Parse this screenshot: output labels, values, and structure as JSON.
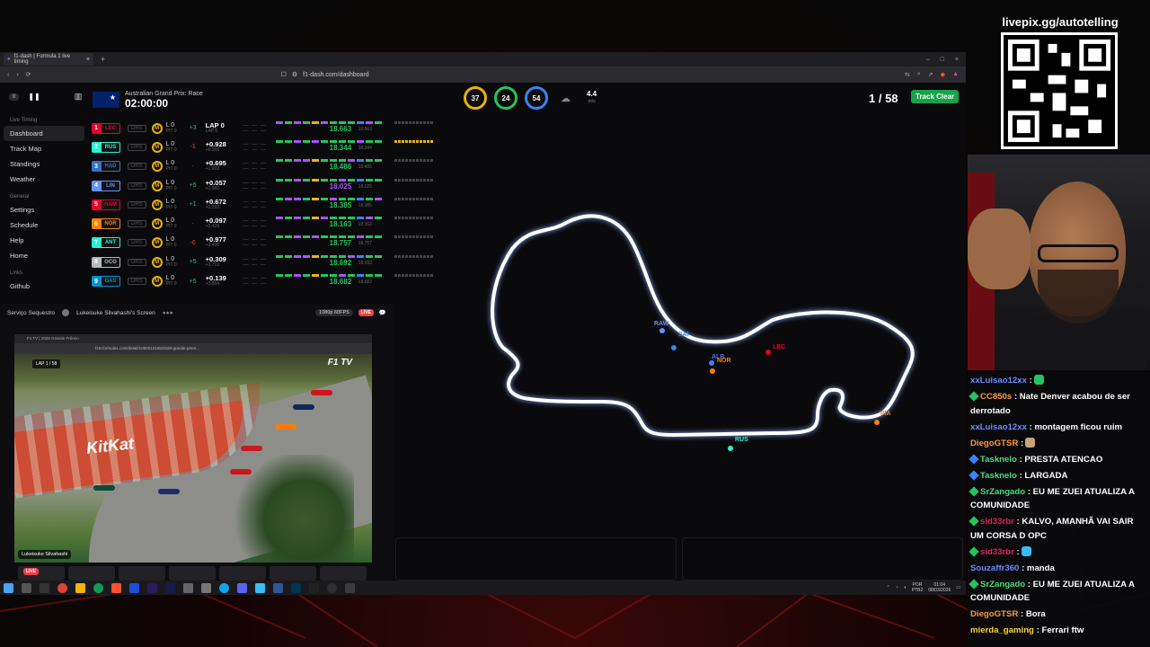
{
  "stream": {
    "title": "livepix.gg/autotelling"
  },
  "browser": {
    "tab_title": "f1-dash | Formula 1 live timing",
    "url": "f1-dash.com/dashboard"
  },
  "sidebar": {
    "delay_value": "0",
    "section_live": "Live Timing",
    "live_items": [
      "Dashboard",
      "Track Map",
      "Standings",
      "Weather"
    ],
    "section_general": "General",
    "general_items": [
      "Settings",
      "Schedule",
      "Help",
      "Home"
    ],
    "section_links": "Links",
    "link_items": [
      "Github"
    ]
  },
  "header": {
    "race_name": "Australian Grand Prix: Race",
    "race_clock": "02:00:00",
    "gauges": [
      {
        "value": "37",
        "label": "TRC"
      },
      {
        "value": "24",
        "label": "AIR"
      },
      {
        "value": "54",
        "label": "%"
      }
    ],
    "wind_value": "4.4",
    "wind_unit": "m/s",
    "lap_counter": "1 / 58",
    "track_status": "Track Clear"
  },
  "leaderboard": [
    {
      "pos": "1",
      "code": "LEC",
      "color": "#e8002d",
      "drs": "DRS",
      "laps": "L 0",
      "pit": "PIT 0",
      "chg": "+3",
      "dir": "up",
      "gap": "LAP 0",
      "gap2": "LAP 0",
      "s_time": "18.663",
      "s_time2": "18.663"
    },
    {
      "pos": "2",
      "code": "RUS",
      "color": "#27f4d2",
      "drs": "DRS",
      "laps": "L 0",
      "pit": "PIT 0",
      "chg": "-1",
      "dir": "down",
      "gap": "+0.928",
      "gap2": "+0.928",
      "s_time": "18.344",
      "s_time2": "18.344"
    },
    {
      "pos": "3",
      "code": "HAD",
      "color": "#3671c6",
      "drs": "DRS",
      "laps": "L 0",
      "pit": "PIT 0",
      "chg": "-",
      "dir": "none",
      "gap": "+0.695",
      "gap2": "+1.603",
      "s_time": "18.486",
      "s_time2": "18.486"
    },
    {
      "pos": "4",
      "code": "LIN",
      "color": "#6692ff",
      "drs": "DRS",
      "laps": "L 0",
      "pit": "PIT 0",
      "chg": "+5",
      "dir": "up",
      "gap": "+0.057",
      "gap2": "+1.660",
      "s_time": "18.025",
      "s_time2": "18.025"
    },
    {
      "pos": "5",
      "code": "HAM",
      "color": "#e8002d",
      "drs": "DRS",
      "laps": "L 0",
      "pit": "PIT 0",
      "chg": "+1",
      "dir": "up",
      "gap": "+0.672",
      "gap2": "+2.332",
      "s_time": "18.385",
      "s_time2": "18.385"
    },
    {
      "pos": "6",
      "code": "NOR",
      "color": "#ff8000",
      "drs": "DRS",
      "laps": "L 0",
      "pit": "PIT 0",
      "chg": "-",
      "dir": "none",
      "gap": "+0.097",
      "gap2": "+2.429",
      "s_time": "18.163",
      "s_time2": "18.163"
    },
    {
      "pos": "7",
      "code": "ANT",
      "color": "#27f4d2",
      "drs": "DRS",
      "laps": "L 0",
      "pit": "PIT 0",
      "chg": "-6",
      "dir": "down",
      "gap": "+0.977",
      "gap2": "+3.406",
      "s_time": "18.757",
      "s_time2": "18.757"
    },
    {
      "pos": "8",
      "code": "OCO",
      "color": "#b6babd",
      "drs": "DRS",
      "laps": "L 0",
      "pit": "PIT 0",
      "chg": "+5",
      "dir": "up",
      "gap": "+0.309",
      "gap2": "+3.715",
      "s_time": "18.692",
      "s_time2": "18.692"
    },
    {
      "pos": "9",
      "code": "GAS",
      "color": "#0093cc",
      "drs": "DRS",
      "laps": "L 0",
      "pit": "PIT 0",
      "chg": "+5",
      "dir": "up",
      "gap": "+0.139",
      "gap2": "+3.854",
      "s_time": "18.682",
      "s_time2": "18.682"
    }
  ],
  "track_map": {
    "drivers": [
      {
        "code": "RAW",
        "color": "#6692ff"
      },
      {
        "code": "SAI",
        "color": "#3b82f6"
      },
      {
        "code": "ALB",
        "color": "#3b82f6"
      },
      {
        "code": "NOR",
        "color": "#ff8000"
      },
      {
        "code": "LEC",
        "color": "#e8002d"
      },
      {
        "code": "PIA",
        "color": "#ff8000"
      },
      {
        "code": "RUS",
        "color": "#27f4d2"
      }
    ]
  },
  "discord": {
    "server": "Serviço Sequestro",
    "screen_title": "Lukeisuke Silvahashi's Screen",
    "quality": "1080p 60FPS",
    "live": "LIVE",
    "inner_tab": "F1 TV | 2026 Grande Prêmio",
    "inner_url": "f1tv.formula1.com/detail/1000010165/2026-grande-prem...",
    "lap_overlay": "LAP 1 / 58",
    "f1tv_logo": "F1 TV",
    "kitkat": "KitKat",
    "streamer_tag": "Lukeisuke Silvahashi"
  },
  "taskbar": {
    "lang": "POR",
    "layout": "PTB2",
    "time": "01:04",
    "date": "08/03/2026"
  },
  "chat": [
    {
      "user": "xxLuisao12xx",
      "color": "#6b8cff",
      "badge": "",
      "text": ":",
      "emote": "#22c55e"
    },
    {
      "user": "CC850s",
      "color": "#ff9a3c",
      "badge": "#22c55e",
      "text": ": Nate Denver acabou de ser derrotado",
      "emote": ""
    },
    {
      "user": "xxLuisao12xx",
      "color": "#6b8cff",
      "badge": "",
      "text": ": montagem ficou ruim",
      "emote": ""
    },
    {
      "user": "DiegoGTSR",
      "color": "#ff9a3c",
      "badge": "",
      "text": ":",
      "emote": "#c9a27a"
    },
    {
      "user": "Tasknelo",
      "color": "#4ade80",
      "badge": "#3b82f6",
      "text": ": PRESTA ATENCAO",
      "emote": ""
    },
    {
      "user": "Tasknelo",
      "color": "#4ade80",
      "badge": "#3b82f6",
      "text": ": LARGADA",
      "emote": ""
    },
    {
      "user": "SrZangado",
      "color": "#4ade80",
      "badge": "#22c55e",
      "text": ": EU ME ZUEI ATUALIZA A COMUNIDADE",
      "emote": ""
    },
    {
      "user": "sid33rbr",
      "color": "#e0245e",
      "badge": "#22c55e",
      "text": ": KALVO, AMANHÃ VAI SAIR UM CORSA D OPC",
      "emote": ""
    },
    {
      "user": "sid33rbr",
      "color": "#e0245e",
      "badge": "#22c55e",
      "text": ":",
      "emote": "#38bdf8"
    },
    {
      "user": "Souzaffr360",
      "color": "#6b8cff",
      "badge": "",
      "text": ": manda",
      "emote": ""
    },
    {
      "user": "SrZangado",
      "color": "#4ade80",
      "badge": "#22c55e",
      "text": ": EU ME ZUEI ATUALIZA A COMUNIDADE",
      "emote": ""
    },
    {
      "user": "DiegoGTSR",
      "color": "#ff9a3c",
      "badge": "",
      "text": ": Bora",
      "emote": ""
    },
    {
      "user": "mierda_gaming",
      "color": "#ffd43b",
      "badge": "",
      "text": ": Ferrari ftw",
      "emote": ""
    }
  ]
}
